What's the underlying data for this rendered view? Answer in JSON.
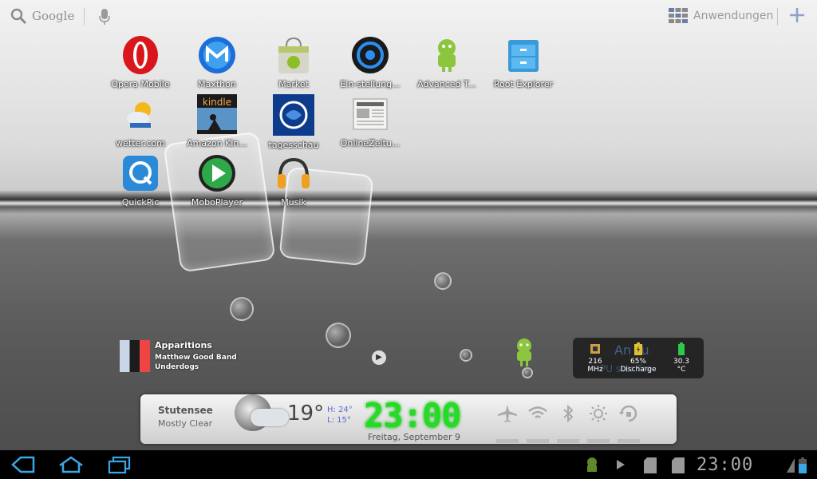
{
  "topbar": {
    "search_label": "Google",
    "apps_label": "Anwendungen"
  },
  "apps": [
    {
      "label": "Opera Mobile"
    },
    {
      "label": "Maxthon"
    },
    {
      "label": "Market"
    },
    {
      "label": "Ein-stellung..."
    },
    {
      "label": "Advanced T..."
    },
    {
      "label": "Root Explorer"
    },
    {
      "label": "wetter.com"
    },
    {
      "label": "Amazon Kin..."
    },
    {
      "label": "tagesschau"
    },
    {
      "label": "OnlineZeitu..."
    },
    {
      "label": "QuickPic"
    },
    {
      "label": "MoboPlayer"
    },
    {
      "label": "Musik"
    }
  ],
  "kindle_text": "kindle",
  "music_widget": {
    "title": "Apparitions",
    "artist": "Matthew Good Band",
    "album": "Underdogs"
  },
  "system_widget": {
    "cpu": "216\nMHz",
    "cpu_value": "216",
    "cpu_unit": "MHz",
    "battery_value": "65%",
    "battery_label": "Discharge",
    "temp_value": "30.3",
    "temp_unit": "°C",
    "ghost_text": "An  Tu",
    "ghost_text2": "PU  ster Fre"
  },
  "weather": {
    "city": "Stutensee",
    "condition": "Mostly Clear",
    "temp": "19°",
    "high": "H: 24°",
    "low": "L: 15°",
    "clock": "23:00",
    "date": "Freitag, September 9"
  },
  "statusbar": {
    "time": "23:00"
  },
  "colors": {
    "clock_green": "#22dd22",
    "accent_blue": "#5c6bd0"
  }
}
